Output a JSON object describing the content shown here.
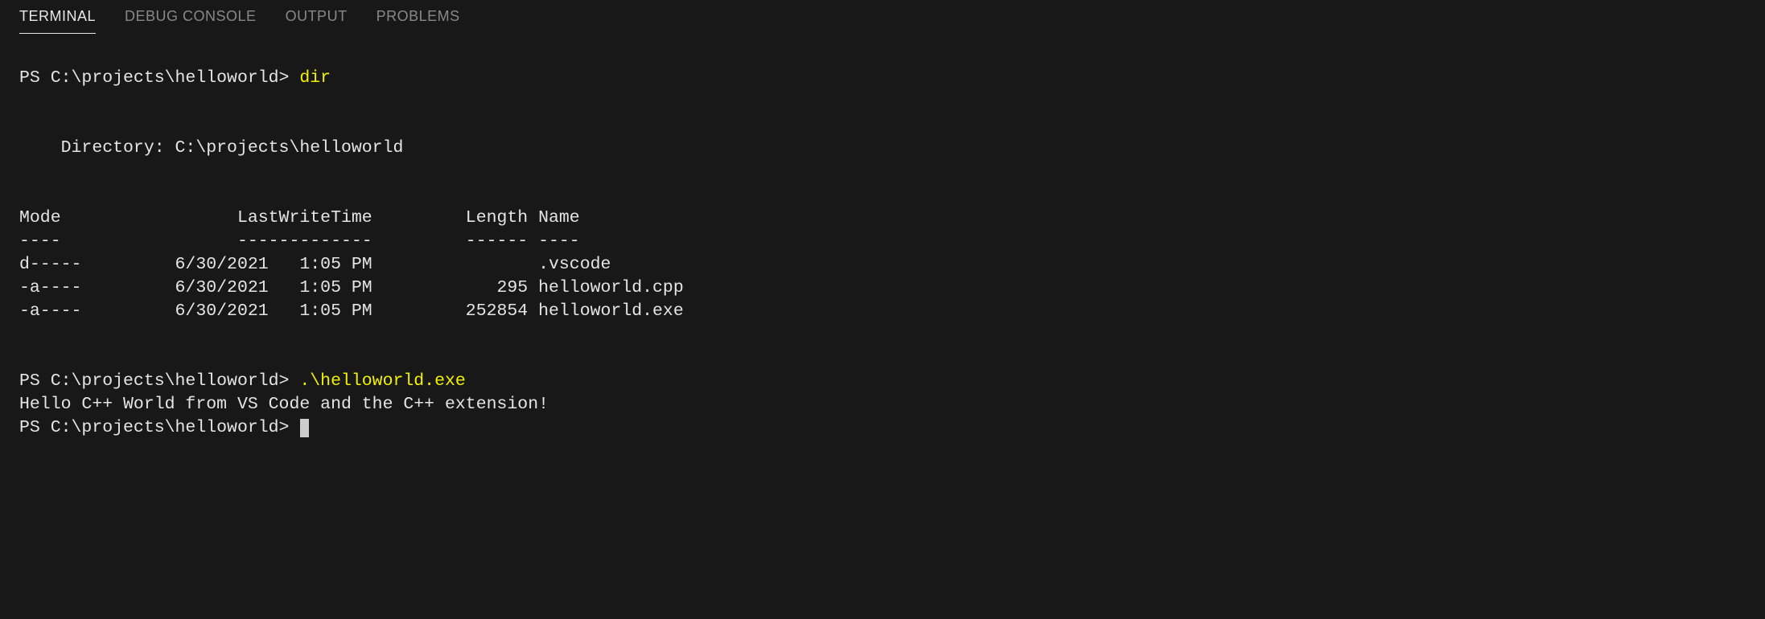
{
  "tabs": {
    "terminal": "TERMINAL",
    "debug_console": "DEBUG CONSOLE",
    "output": "OUTPUT",
    "problems": "PROBLEMS"
  },
  "terminal": {
    "prompt1": "PS C:\\projects\\helloworld> ",
    "cmd1": "dir",
    "blank1": "",
    "blank2": "",
    "dir_line": "    Directory: C:\\projects\\helloworld",
    "blank3": "",
    "blank4": "",
    "header": "Mode                 LastWriteTime         Length Name",
    "divider": "----                 -------------         ------ ----",
    "row0": "d-----         6/30/2021   1:05 PM                .vscode",
    "row1": "-a----         6/30/2021   1:05 PM            295 helloworld.cpp",
    "row2": "-a----         6/30/2021   1:05 PM         252854 helloworld.exe",
    "blank5": "",
    "blank6": "",
    "prompt2": "PS C:\\projects\\helloworld> ",
    "cmd2": ".\\helloworld.exe",
    "output1": "Hello C++ World from VS Code and the C++ extension!",
    "prompt3": "PS C:\\projects\\helloworld> "
  }
}
